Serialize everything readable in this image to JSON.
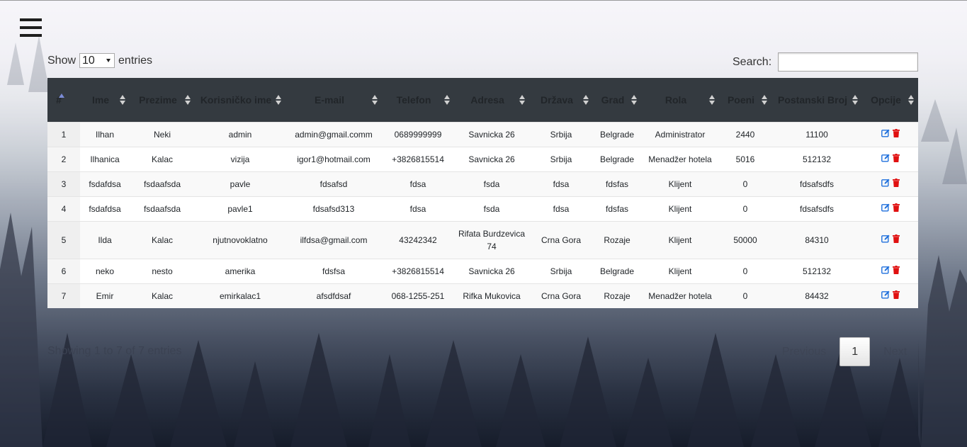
{
  "menu": {
    "icon": "hamburger-menu-icon"
  },
  "length": {
    "show_label": "Show",
    "value": "10",
    "entries_label": "entries"
  },
  "search": {
    "label": "Search:",
    "value": ""
  },
  "table": {
    "columns": [
      "#",
      "Ime",
      "Prezime",
      "Korisničko ime",
      "E-mail",
      "Telefon",
      "Adresa",
      "Država",
      "Grad",
      "Rola",
      "Poeni",
      "Postanski Broj",
      "Opcije"
    ],
    "sorted_column": "#",
    "sort_direction": "asc",
    "rows": [
      [
        "1",
        "Ilhan",
        "Neki",
        "admin",
        "admin@gmail.comm",
        "0689999999",
        "Savnicka 26",
        "Srbija",
        "Belgrade",
        "Administrator",
        "2440",
        "11100"
      ],
      [
        "2",
        "Ilhanica",
        "Kalac",
        "vizija",
        "igor1@hotmail.com",
        "+3826815514",
        "Savnicka 26",
        "Srbija",
        "Belgrade",
        "Menadžer hotela",
        "5016",
        "512132"
      ],
      [
        "3",
        "fsdafdsa",
        "fsdaafsda",
        "pavle",
        "fdsafsd",
        "fdsa",
        "fsda",
        "fdsa",
        "fdsfas",
        "Klijent",
        "0",
        "fdsafsdfs"
      ],
      [
        "4",
        "fsdafdsa",
        "fsdaafsda",
        "pavle1",
        "fdsafsd313",
        "fdsa",
        "fsda",
        "fdsa",
        "fdsfas",
        "Klijent",
        "0",
        "fdsafsdfs"
      ],
      [
        "5",
        "Ilda",
        "Kalac",
        "njutnovoklatno",
        "ilfdsa@gmail.com",
        "43242342",
        "Rifata Burdzevica 74",
        "Crna Gora",
        "Rozaje",
        "Klijent",
        "50000",
        "84310"
      ],
      [
        "6",
        "neko",
        "nesto",
        "amerika",
        "fdsfsa",
        "+3826815514",
        "Savnicka 26",
        "Srbija",
        "Belgrade",
        "Klijent",
        "0",
        "512132"
      ],
      [
        "7",
        "Emir",
        "Kalac",
        "emirkalac1",
        "afsdfdsaf",
        "068-1255-251",
        "Rifka Mukovica",
        "Crna Gora",
        "Rozaje",
        "Menadžer hotela",
        "0",
        "84432"
      ]
    ],
    "row_actions": {
      "edit_icon": "edit-icon",
      "delete_icon": "trash-icon",
      "edit_color": "#1e6fdc",
      "delete_color": "#e01010"
    }
  },
  "info": "Showing 1 to 7 of 7 entries",
  "pagination": {
    "previous": "Previous",
    "pages": [
      "1"
    ],
    "current": "1",
    "next": "Next"
  },
  "colors": {
    "header_bg": "#343a40",
    "sort_active": "#7b8bd6"
  }
}
